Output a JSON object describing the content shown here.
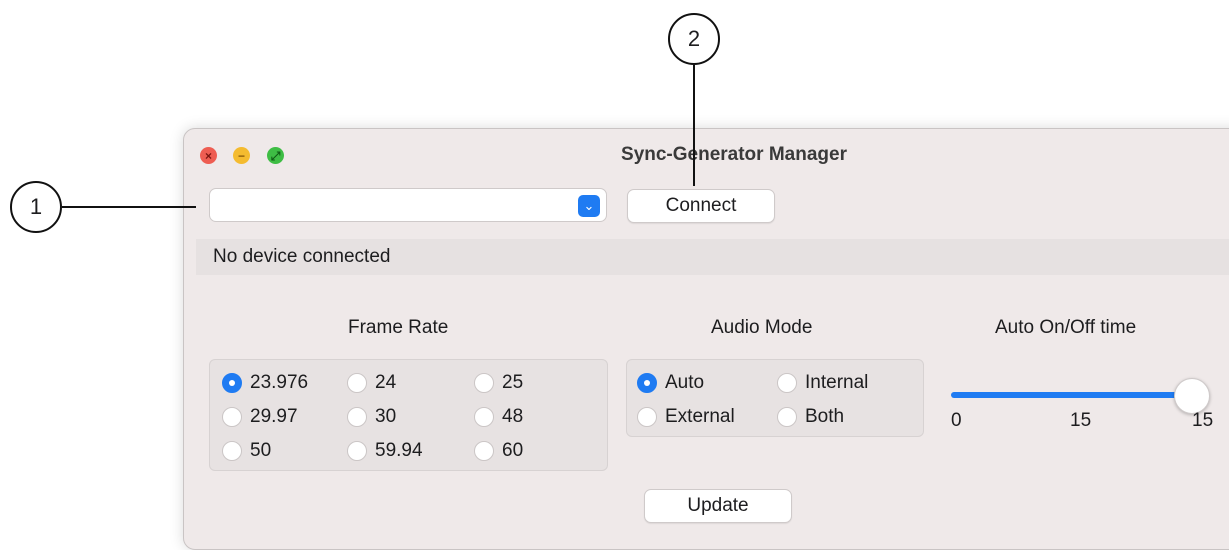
{
  "callouts": {
    "one": "1",
    "two": "2"
  },
  "window": {
    "title": "Sync-Generator Manager"
  },
  "toolbar": {
    "connect_label": "Connect",
    "device_select_value": ""
  },
  "status": {
    "text": "No device connected"
  },
  "frame_rate": {
    "label": "Frame Rate",
    "options": [
      "23.976",
      "24",
      "25",
      "29.97",
      "30",
      "48",
      "50",
      "59.94",
      "60"
    ],
    "selected": "23.976"
  },
  "audio_mode": {
    "label": "Audio Mode",
    "options": [
      "Auto",
      "Internal",
      "External",
      "Both"
    ],
    "selected": "Auto"
  },
  "auto_time": {
    "label": "Auto On/Off time",
    "ticks": [
      "0",
      "15",
      "15"
    ],
    "value": 15,
    "min": 0,
    "max": 15
  },
  "actions": {
    "update_label": "Update"
  },
  "colors": {
    "accent": "#1f7bf2",
    "window_bg": "#efe9e9"
  }
}
